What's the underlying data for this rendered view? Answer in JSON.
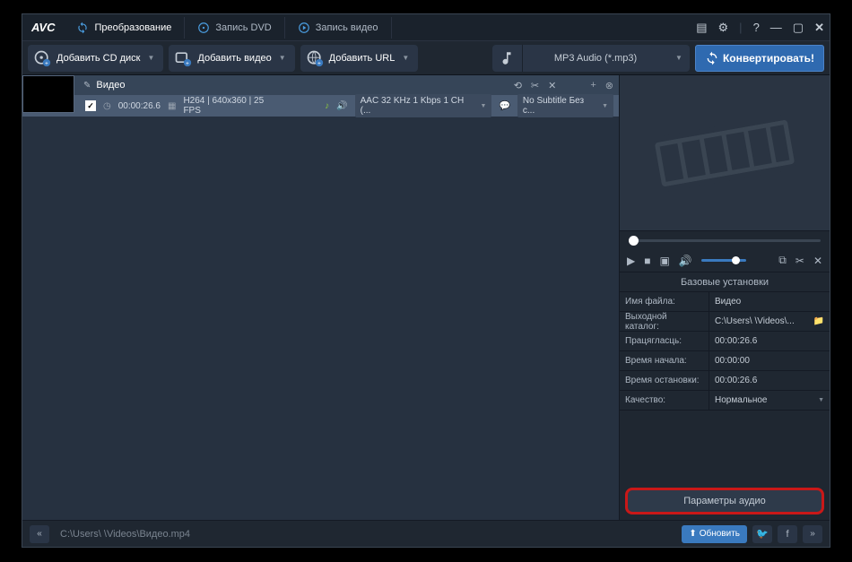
{
  "logo": "AVC",
  "tabs": {
    "convert": "Преобразование",
    "dvd": "Запись DVD",
    "video": "Запись видео"
  },
  "toolbar": {
    "add_cd": "Добавить CD диск",
    "add_video": "Добавить видео",
    "add_url": "Добавить URL"
  },
  "format": {
    "selected": "MP3 Audio (*.mp3)"
  },
  "convert_button": "Конвертировать!",
  "item": {
    "title": "Видео",
    "duration": "00:00:26.6",
    "video_info": "H264 | 640x360 | 25 FPS",
    "audio_info": "AAC 32 KHz 1 Kbps 1 CH (...",
    "subtitle": "No Subtitle Без с..."
  },
  "settings": {
    "header": "Базовые установки",
    "filename_lab": "Имя файла:",
    "filename": "Видео",
    "output_lab": "Выходной каталог:",
    "output": "C:\\Users\\          \\Videos\\...",
    "durationlab": "Працягласць:",
    "duration": "00:00:26.6",
    "start_lab": "Время начала:",
    "start": "00:00:00",
    "stop_lab": "Время остановки:",
    "stop": "00:00:26.6",
    "quality_lab": "Качество:",
    "quality": "Нормальное"
  },
  "params_button": "Параметры аудио",
  "status": {
    "path": "C:\\Users\\          \\Videos\\Видео.mp4",
    "update": "Обновить"
  }
}
